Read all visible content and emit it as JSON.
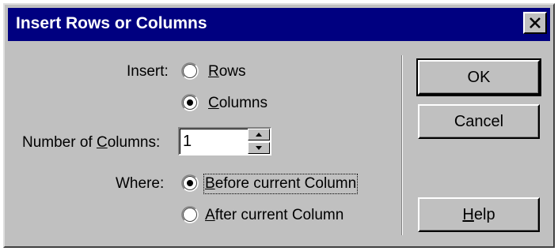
{
  "dialog": {
    "title": "Insert Rows or Columns",
    "close_icon": "close-icon"
  },
  "insert": {
    "label": "Insert:",
    "options": [
      {
        "label_prefix": "",
        "accel": "R",
        "label_rest": "ows",
        "selected": false
      },
      {
        "label_prefix": "",
        "accel": "C",
        "label_rest": "olumns",
        "selected": true
      }
    ]
  },
  "number": {
    "label_prefix": "Number of ",
    "accel": "C",
    "label_rest": "olumns:",
    "value": "1"
  },
  "where": {
    "label": "Where:",
    "options": [
      {
        "accel": "B",
        "label_rest": "efore current Column",
        "selected": true
      },
      {
        "accel": "A",
        "label_rest": "fter current Column",
        "selected": false
      }
    ]
  },
  "buttons": {
    "ok": "OK",
    "cancel": "Cancel",
    "help_accel": "H",
    "help_rest": "elp"
  }
}
